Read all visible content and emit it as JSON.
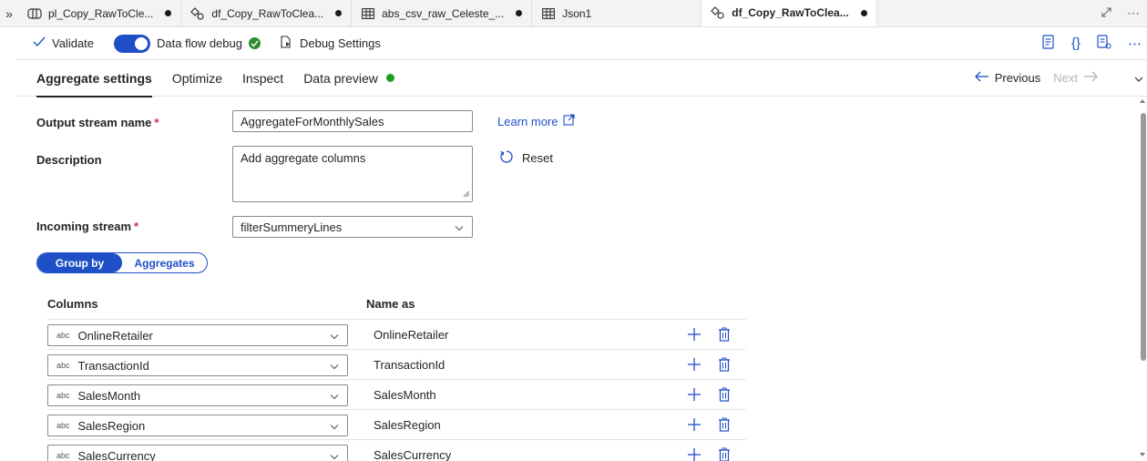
{
  "tabs": [
    {
      "label": "pl_Copy_RawToCle...",
      "icon": "pipeline-icon",
      "active": false
    },
    {
      "label": "df_Copy_RawToClea...",
      "icon": "dataflow-icon",
      "active": false
    },
    {
      "label": "abs_csv_raw_Celeste_...",
      "icon": "table-icon",
      "active": false
    },
    {
      "label": "Json1",
      "icon": "table-icon",
      "active": false
    },
    {
      "label": "df_Copy_RawToClea...",
      "icon": "dataflow-icon",
      "active": true
    }
  ],
  "toolbar": {
    "validate": "Validate",
    "debug": "Data flow debug",
    "debug_settings": "Debug Settings"
  },
  "subtabs": {
    "aggregate": "Aggregate settings",
    "optimize": "Optimize",
    "inspect": "Inspect",
    "preview": "Data preview",
    "previous": "Previous",
    "next": "Next"
  },
  "form": {
    "output_label": "Output stream name",
    "output_value": "AggregateForMonthlySales",
    "learn_more": "Learn more",
    "description_label": "Description",
    "description_value": "Add aggregate columns",
    "reset": "Reset",
    "incoming_label": "Incoming stream",
    "incoming_value": "filterSummeryLines",
    "required_mark": "*"
  },
  "segment": {
    "group_by": "Group by",
    "aggregates": "Aggregates"
  },
  "grid": {
    "columns_header": "Columns",
    "name_header": "Name as",
    "type_tag": "abc",
    "rows": [
      {
        "column": "OnlineRetailer",
        "name": "OnlineRetailer"
      },
      {
        "column": "TransactionId",
        "name": "TransactionId"
      },
      {
        "column": "SalesMonth",
        "name": "SalesMonth"
      },
      {
        "column": "SalesRegion",
        "name": "SalesRegion"
      },
      {
        "column": "SalesCurrency",
        "name": "SalesCurrency"
      }
    ]
  },
  "colors": {
    "accent": "#1f4fc7",
    "success": "#1f9d1f",
    "required": "#c4314b"
  }
}
